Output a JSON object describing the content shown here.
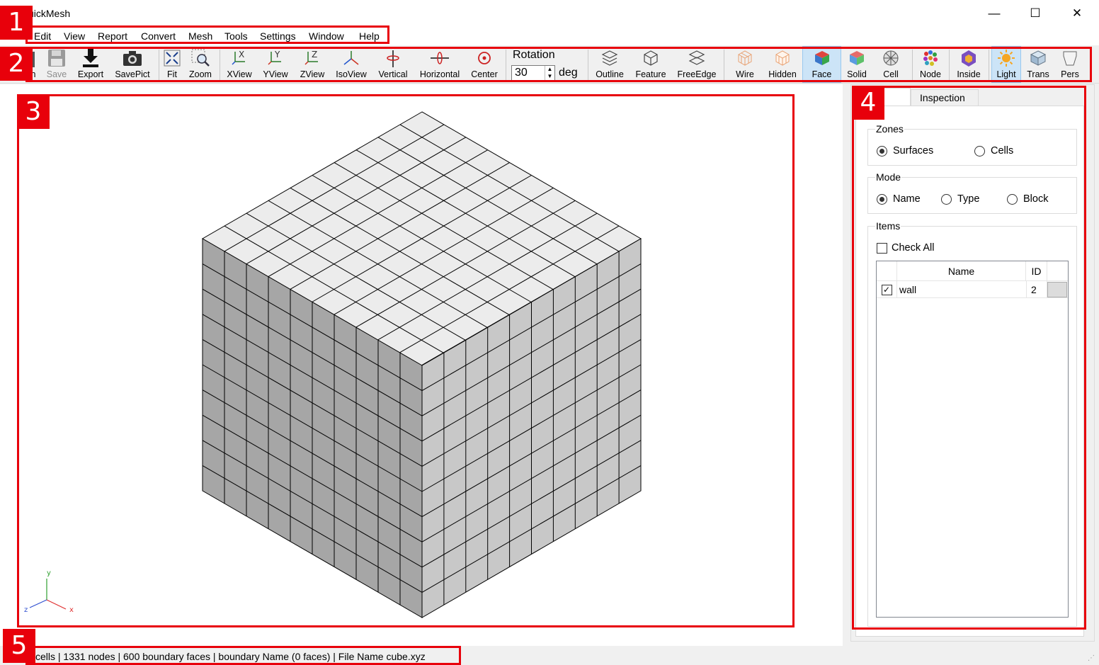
{
  "window": {
    "title": "uickMesh",
    "controls": {
      "minimize": "—",
      "maximize": "☐",
      "close": "✕"
    }
  },
  "menubar": {
    "items": [
      "Edit",
      "View",
      "Report",
      "Convert",
      "Mesh",
      "Tools",
      "Settings",
      "Window",
      "Help"
    ]
  },
  "toolbar": {
    "buttons": [
      {
        "label": "n",
        "icon": "open-icon",
        "state": "normal"
      },
      {
        "label": "Save",
        "icon": "save-icon",
        "state": "disabled"
      },
      {
        "label": "Export",
        "icon": "export-icon",
        "state": "normal"
      },
      {
        "label": "SavePict",
        "icon": "camera-icon",
        "state": "normal"
      },
      {
        "label": "Fit",
        "icon": "fit-icon",
        "state": "normal"
      },
      {
        "label": "Zoom",
        "icon": "zoom-icon",
        "state": "normal"
      },
      {
        "label": "XView",
        "icon": "xview-icon",
        "state": "normal"
      },
      {
        "label": "YView",
        "icon": "yview-icon",
        "state": "normal"
      },
      {
        "label": "ZView",
        "icon": "zview-icon",
        "state": "normal"
      },
      {
        "label": "IsoView",
        "icon": "isoview-icon",
        "state": "normal"
      },
      {
        "label": "Vertical",
        "icon": "vertical-rotate-icon",
        "state": "normal"
      },
      {
        "label": "Horizontal",
        "icon": "horizontal-rotate-icon",
        "state": "normal"
      },
      {
        "label": "Center",
        "icon": "center-icon",
        "state": "normal"
      },
      {
        "label": "Outline",
        "icon": "outline-icon",
        "state": "normal"
      },
      {
        "label": "Feature",
        "icon": "feature-icon",
        "state": "normal"
      },
      {
        "label": "FreeEdge",
        "icon": "free-edge-icon",
        "state": "normal"
      },
      {
        "label": "Wire",
        "icon": "wire-icon",
        "state": "normal"
      },
      {
        "label": "Hidden",
        "icon": "hidden-icon",
        "state": "normal"
      },
      {
        "label": "Face",
        "icon": "face-icon",
        "state": "active"
      },
      {
        "label": "Solid",
        "icon": "solid-icon",
        "state": "normal"
      },
      {
        "label": "Cell",
        "icon": "cell-icon",
        "state": "normal"
      },
      {
        "label": "Node",
        "icon": "node-icon",
        "state": "normal"
      },
      {
        "label": "Inside",
        "icon": "inside-icon",
        "state": "normal"
      },
      {
        "label": "Light",
        "icon": "light-icon",
        "state": "active"
      },
      {
        "label": "Trans",
        "icon": "trans-icon",
        "state": "normal"
      },
      {
        "label": "Pers",
        "icon": "pers-icon",
        "state": "normal"
      }
    ],
    "rotation": {
      "label": "Rotation",
      "value": "30",
      "unit": "deg"
    }
  },
  "viewport": {
    "axes": {
      "x": "x",
      "y": "y",
      "z": "z"
    },
    "mesh": {
      "divisions": 10,
      "top_color": "#ececec",
      "left_color": "#a6a6a6",
      "right_color": "#c8c8c8"
    }
  },
  "panel": {
    "tabs": [
      {
        "label": "erty",
        "selected": true
      },
      {
        "label": "Inspection",
        "selected": false
      }
    ],
    "zones": {
      "title": "Zones",
      "options": [
        "Surfaces",
        "Cells"
      ],
      "selected": "Surfaces"
    },
    "mode": {
      "title": "Mode",
      "options": [
        "Name",
        "Type",
        "Block"
      ],
      "selected": "Name"
    },
    "items": {
      "title": "Items",
      "check_all": "Check All",
      "columns": [
        "Name",
        "ID"
      ],
      "rows": [
        {
          "checked": true,
          "name": "wall",
          "id": "2"
        }
      ]
    }
  },
  "statusbar": {
    "text": "cells | 1331 nodes | 600 boundary faces |  boundary Name  (0 faces) | File Name cube.xyz"
  },
  "annotations": {
    "labels": [
      "1",
      "2",
      "3",
      "4",
      "5"
    ],
    "color": "#e8000b"
  }
}
